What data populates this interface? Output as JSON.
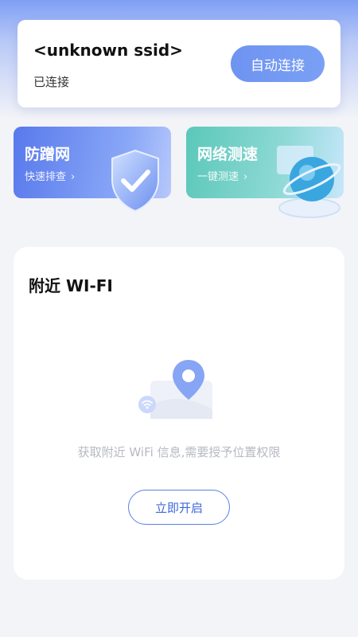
{
  "status": {
    "ssid": "<unknown ssid>",
    "connection_state": "已连接",
    "auto_connect_label": "自动连接"
  },
  "features": [
    {
      "title": "防蹭网",
      "subtitle": "快速排查",
      "icon": "shield-check-icon"
    },
    {
      "title": "网络测速",
      "subtitle": "一键测速",
      "icon": "globe-icon"
    }
  ],
  "nearby": {
    "title": "附近 WI-FI",
    "permission_text": "获取附近 WiFi 信息,需要授予位置权限",
    "enable_label": "立即开启",
    "illustration": "map-pin-wifi-icon"
  },
  "colors": {
    "accent": "#6f93f1",
    "anti_card": "#5879ec",
    "speed_card": "#5bc8b9",
    "hint_text": "#b6b9c1"
  }
}
